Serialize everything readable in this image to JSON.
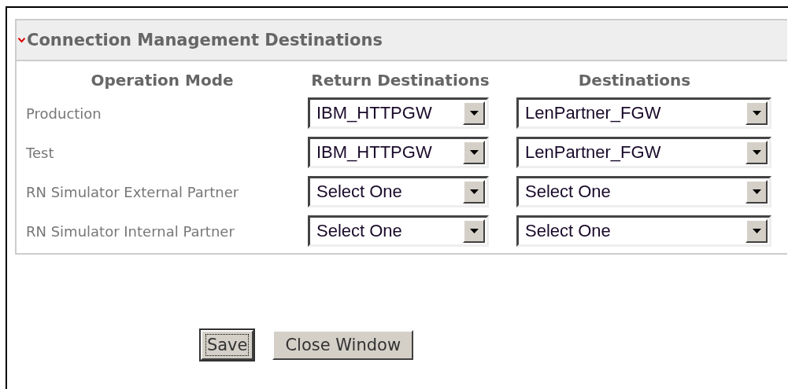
{
  "panel": {
    "title": "Connection Management Destinations",
    "expanded": true
  },
  "columns": [
    "Operation Mode",
    "Return Destinations",
    "Destinations"
  ],
  "rows": [
    {
      "mode": "Production",
      "return_destination": "IBM_HTTPGW",
      "destination": "LenPartner_FGW"
    },
    {
      "mode": "Test",
      "return_destination": "IBM_HTTPGW",
      "destination": "LenPartner_FGW"
    },
    {
      "mode": "RN Simulator External Partner",
      "return_destination": "Select One",
      "destination": "Select One"
    },
    {
      "mode": "RN Simulator Internal Partner",
      "return_destination": "Select One",
      "destination": "Select One"
    }
  ],
  "buttons": [
    {
      "label": "Save",
      "focused": true
    },
    {
      "label": "Close Window",
      "focused": false
    }
  ]
}
